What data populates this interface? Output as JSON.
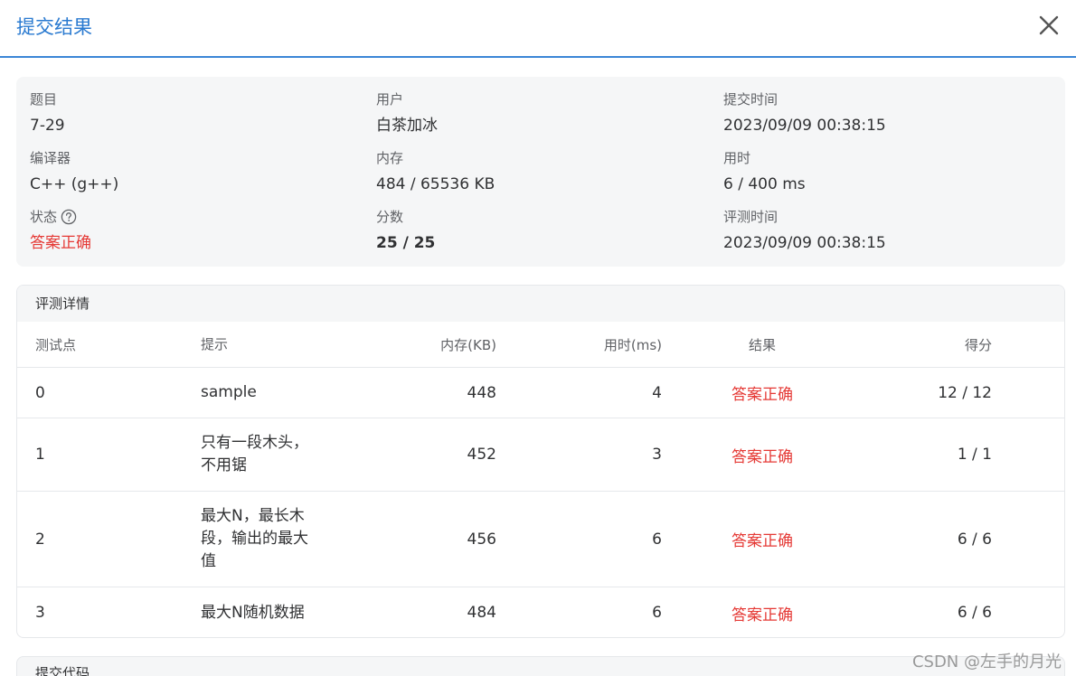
{
  "header": {
    "title": "提交结果",
    "close_icon": "close-icon"
  },
  "info": {
    "problem_label": "题目",
    "problem_value": "7-29",
    "user_label": "用户",
    "user_value": "白茶加冰",
    "submit_time_label": "提交时间",
    "submit_time_value": "2023/09/09 00:38:15",
    "compiler_label": "编译器",
    "compiler_value": "C++ (g++)",
    "memory_label": "内存",
    "memory_value": "484 / 65536 KB",
    "time_label": "用时",
    "time_value": "6 / 400 ms",
    "status_label": "状态",
    "status_value": "答案正确",
    "score_label": "分数",
    "score_value": "25 / 25",
    "judge_time_label": "评测时间",
    "judge_time_value": "2023/09/09 00:38:15"
  },
  "details": {
    "title": "评测详情",
    "columns": [
      "测试点",
      "提示",
      "内存(KB)",
      "用时(ms)",
      "结果",
      "得分"
    ],
    "rows": [
      {
        "test": "0",
        "hint_lines": [
          "sample"
        ],
        "memory": "448",
        "time": "4",
        "result": "答案正确",
        "score": "12 / 12"
      },
      {
        "test": "1",
        "hint_lines": [
          "只有一段木头，",
          "不用锯"
        ],
        "memory": "452",
        "time": "3",
        "result": "答案正确",
        "score": "1 / 1"
      },
      {
        "test": "2",
        "hint_lines": [
          "最大N，最长木",
          "段，输出的最大",
          "值"
        ],
        "memory": "456",
        "time": "6",
        "result": "答案正确",
        "score": "6 / 6"
      },
      {
        "test": "3",
        "hint_lines": [
          "最大N随机数据"
        ],
        "memory": "484",
        "time": "6",
        "result": "答案正确",
        "score": "6 / 6"
      }
    ]
  },
  "code": {
    "title": "提交代码"
  },
  "watermark": "CSDN @左手的月光",
  "colors": {
    "accent": "#2a7ad0",
    "correct": "#e53935",
    "card_bg": "#f5f6f7"
  }
}
